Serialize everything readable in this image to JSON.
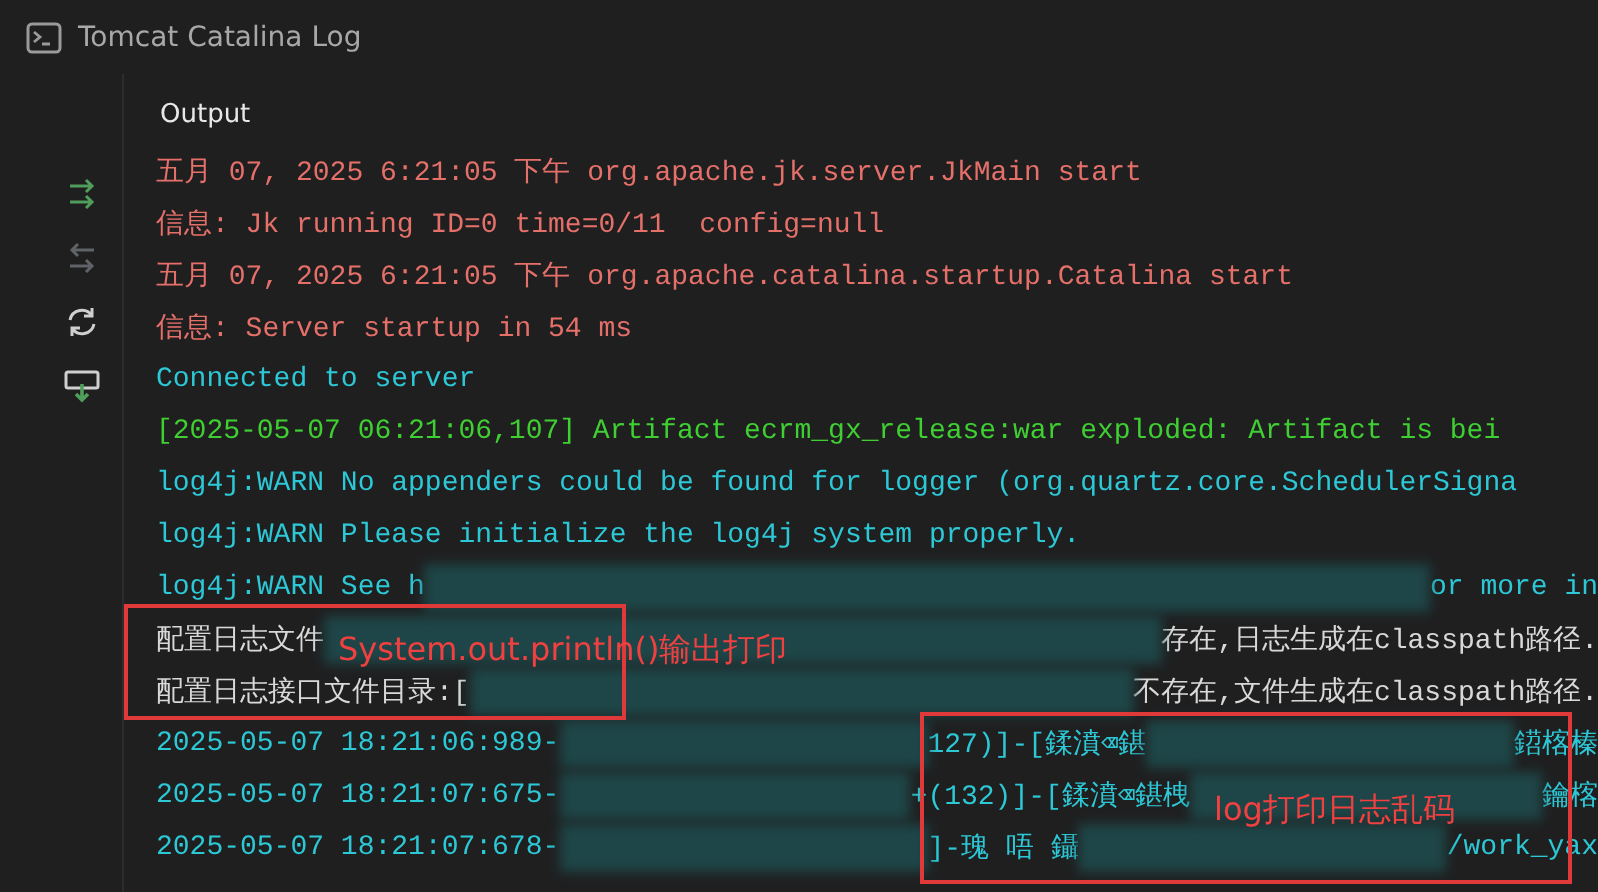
{
  "window": {
    "title": "Tomcat Catalina Log"
  },
  "toolbar": [
    {
      "kind": "wrap"
    },
    {
      "kind": "unwrap"
    },
    {
      "kind": "refresh"
    },
    {
      "kind": "scroll-end"
    }
  ],
  "output": {
    "title": "Output",
    "lines": [
      {
        "kind": "error",
        "parts": [
          {
            "kind": "text",
            "text": "五月 07, 2025 6:21:05 下午 org.apache.jk.server.JkMain start"
          }
        ]
      },
      {
        "kind": "error",
        "parts": [
          {
            "kind": "text",
            "text": "信息: Jk running ID=0 time=0/11  config=null"
          }
        ]
      },
      {
        "kind": "error",
        "parts": [
          {
            "kind": "text",
            "text": "五月 07, 2025 6:21:05 下午 org.apache.catalina.startup.Catalina start"
          }
        ]
      },
      {
        "kind": "error",
        "parts": [
          {
            "kind": "text",
            "text": "信息: Server startup in 54 ms"
          }
        ]
      },
      {
        "kind": "info",
        "parts": [
          {
            "kind": "text",
            "text": "Connected to server"
          }
        ]
      },
      {
        "kind": "success",
        "parts": [
          {
            "kind": "text",
            "text": "[2025-05-07 06:21:06,107] Artifact ecrm_gx_release:war exploded: Artifact is bei"
          }
        ]
      },
      {
        "kind": "info",
        "parts": [
          {
            "kind": "text",
            "text": "log4j:WARN No appenders could be found for logger (org.quartz.core.SchedulerSigna"
          }
        ]
      },
      {
        "kind": "info",
        "parts": [
          {
            "kind": "text",
            "text": "log4j:WARN Please initialize the log4j system properly."
          }
        ]
      },
      {
        "kind": "info",
        "parts": [
          {
            "kind": "text",
            "text": "log4j:WARN See h"
          },
          {
            "kind": "blur"
          },
          {
            "kind": "text",
            "text": "or more in"
          }
        ]
      },
      {
        "kind": "plain",
        "parts": [
          {
            "kind": "text",
            "text": "配置日志文件"
          },
          {
            "kind": "blur"
          },
          {
            "kind": "text",
            "text": "存在,日志生成在classpath路径."
          }
        ]
      },
      {
        "kind": "plain",
        "parts": [
          {
            "kind": "text",
            "text": "配置日志接口文件目录:["
          },
          {
            "kind": "blur"
          },
          {
            "kind": "text",
            "text": "不存在,文件生成在classpath路径."
          }
        ]
      },
      {
        "kind": "info",
        "parts": [
          {
            "kind": "text",
            "text": "2025-05-07 18:21:06:989-"
          },
          {
            "kind": "blur"
          },
          {
            "kind": "text",
            "text": "127)]-[鍒濆⌫鍖"
          },
          {
            "kind": "blur"
          },
          {
            "kind": "text",
            "text": "鍣楁榛"
          }
        ]
      },
      {
        "kind": "info",
        "parts": [
          {
            "kind": "text",
            "text": "2025-05-07 18:21:07:675-"
          },
          {
            "kind": "blur"
          },
          {
            "kind": "text",
            "text": "+(132)]-[鍒濆⌫鍖栧"
          },
          {
            "kind": "blur"
          },
          {
            "kind": "text",
            "text": "鑰楁"
          }
        ]
      },
      {
        "kind": "info",
        "parts": [
          {
            "kind": "text",
            "text": "2025-05-07 18:21:07:678-"
          },
          {
            "kind": "blur"
          },
          {
            "kind": "text",
            "text": "]-瑰 唔 鑷"
          },
          {
            "kind": "blur"
          },
          {
            "kind": "text",
            "text": "/work_yax"
          }
        ]
      }
    ]
  },
  "annotations": [
    {
      "kind": "box-top",
      "text": "System.out.println()输出打印"
    },
    {
      "kind": "box-bottom",
      "text": "log打印日志乱码"
    }
  ]
}
